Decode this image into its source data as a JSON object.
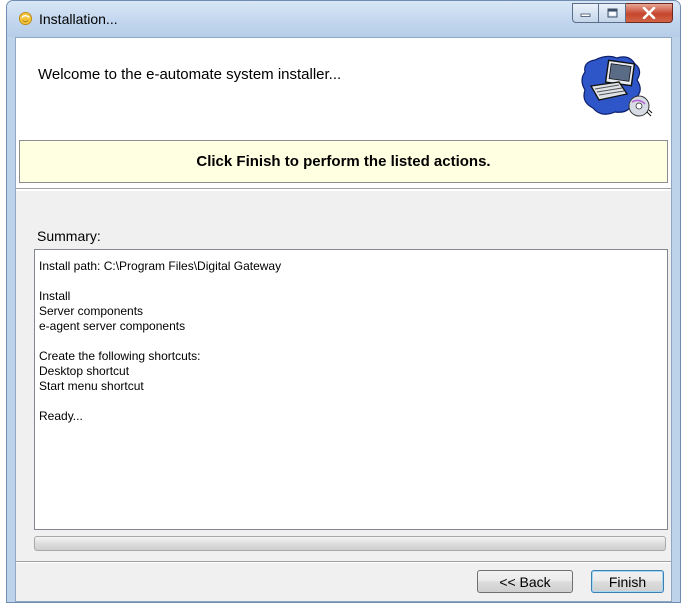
{
  "window": {
    "title": "Installation...",
    "caption_buttons": [
      "minimize",
      "maximize",
      "close"
    ]
  },
  "header": {
    "welcome_text": "Welcome to the e-automate system installer...",
    "icon": "computer-disc-icon"
  },
  "banner": {
    "text": "Click Finish to perform the listed actions."
  },
  "summary": {
    "label": "Summary:",
    "lines": [
      "Install path: C:\\Program Files\\Digital Gateway",
      "",
      "Install",
      "Server components",
      "e-agent server components",
      "",
      "Create the following shortcuts:",
      "Desktop shortcut",
      "Start menu shortcut",
      "",
      "Ready..."
    ]
  },
  "footer": {
    "back_label": "<< Back",
    "finish_label": "Finish"
  }
}
